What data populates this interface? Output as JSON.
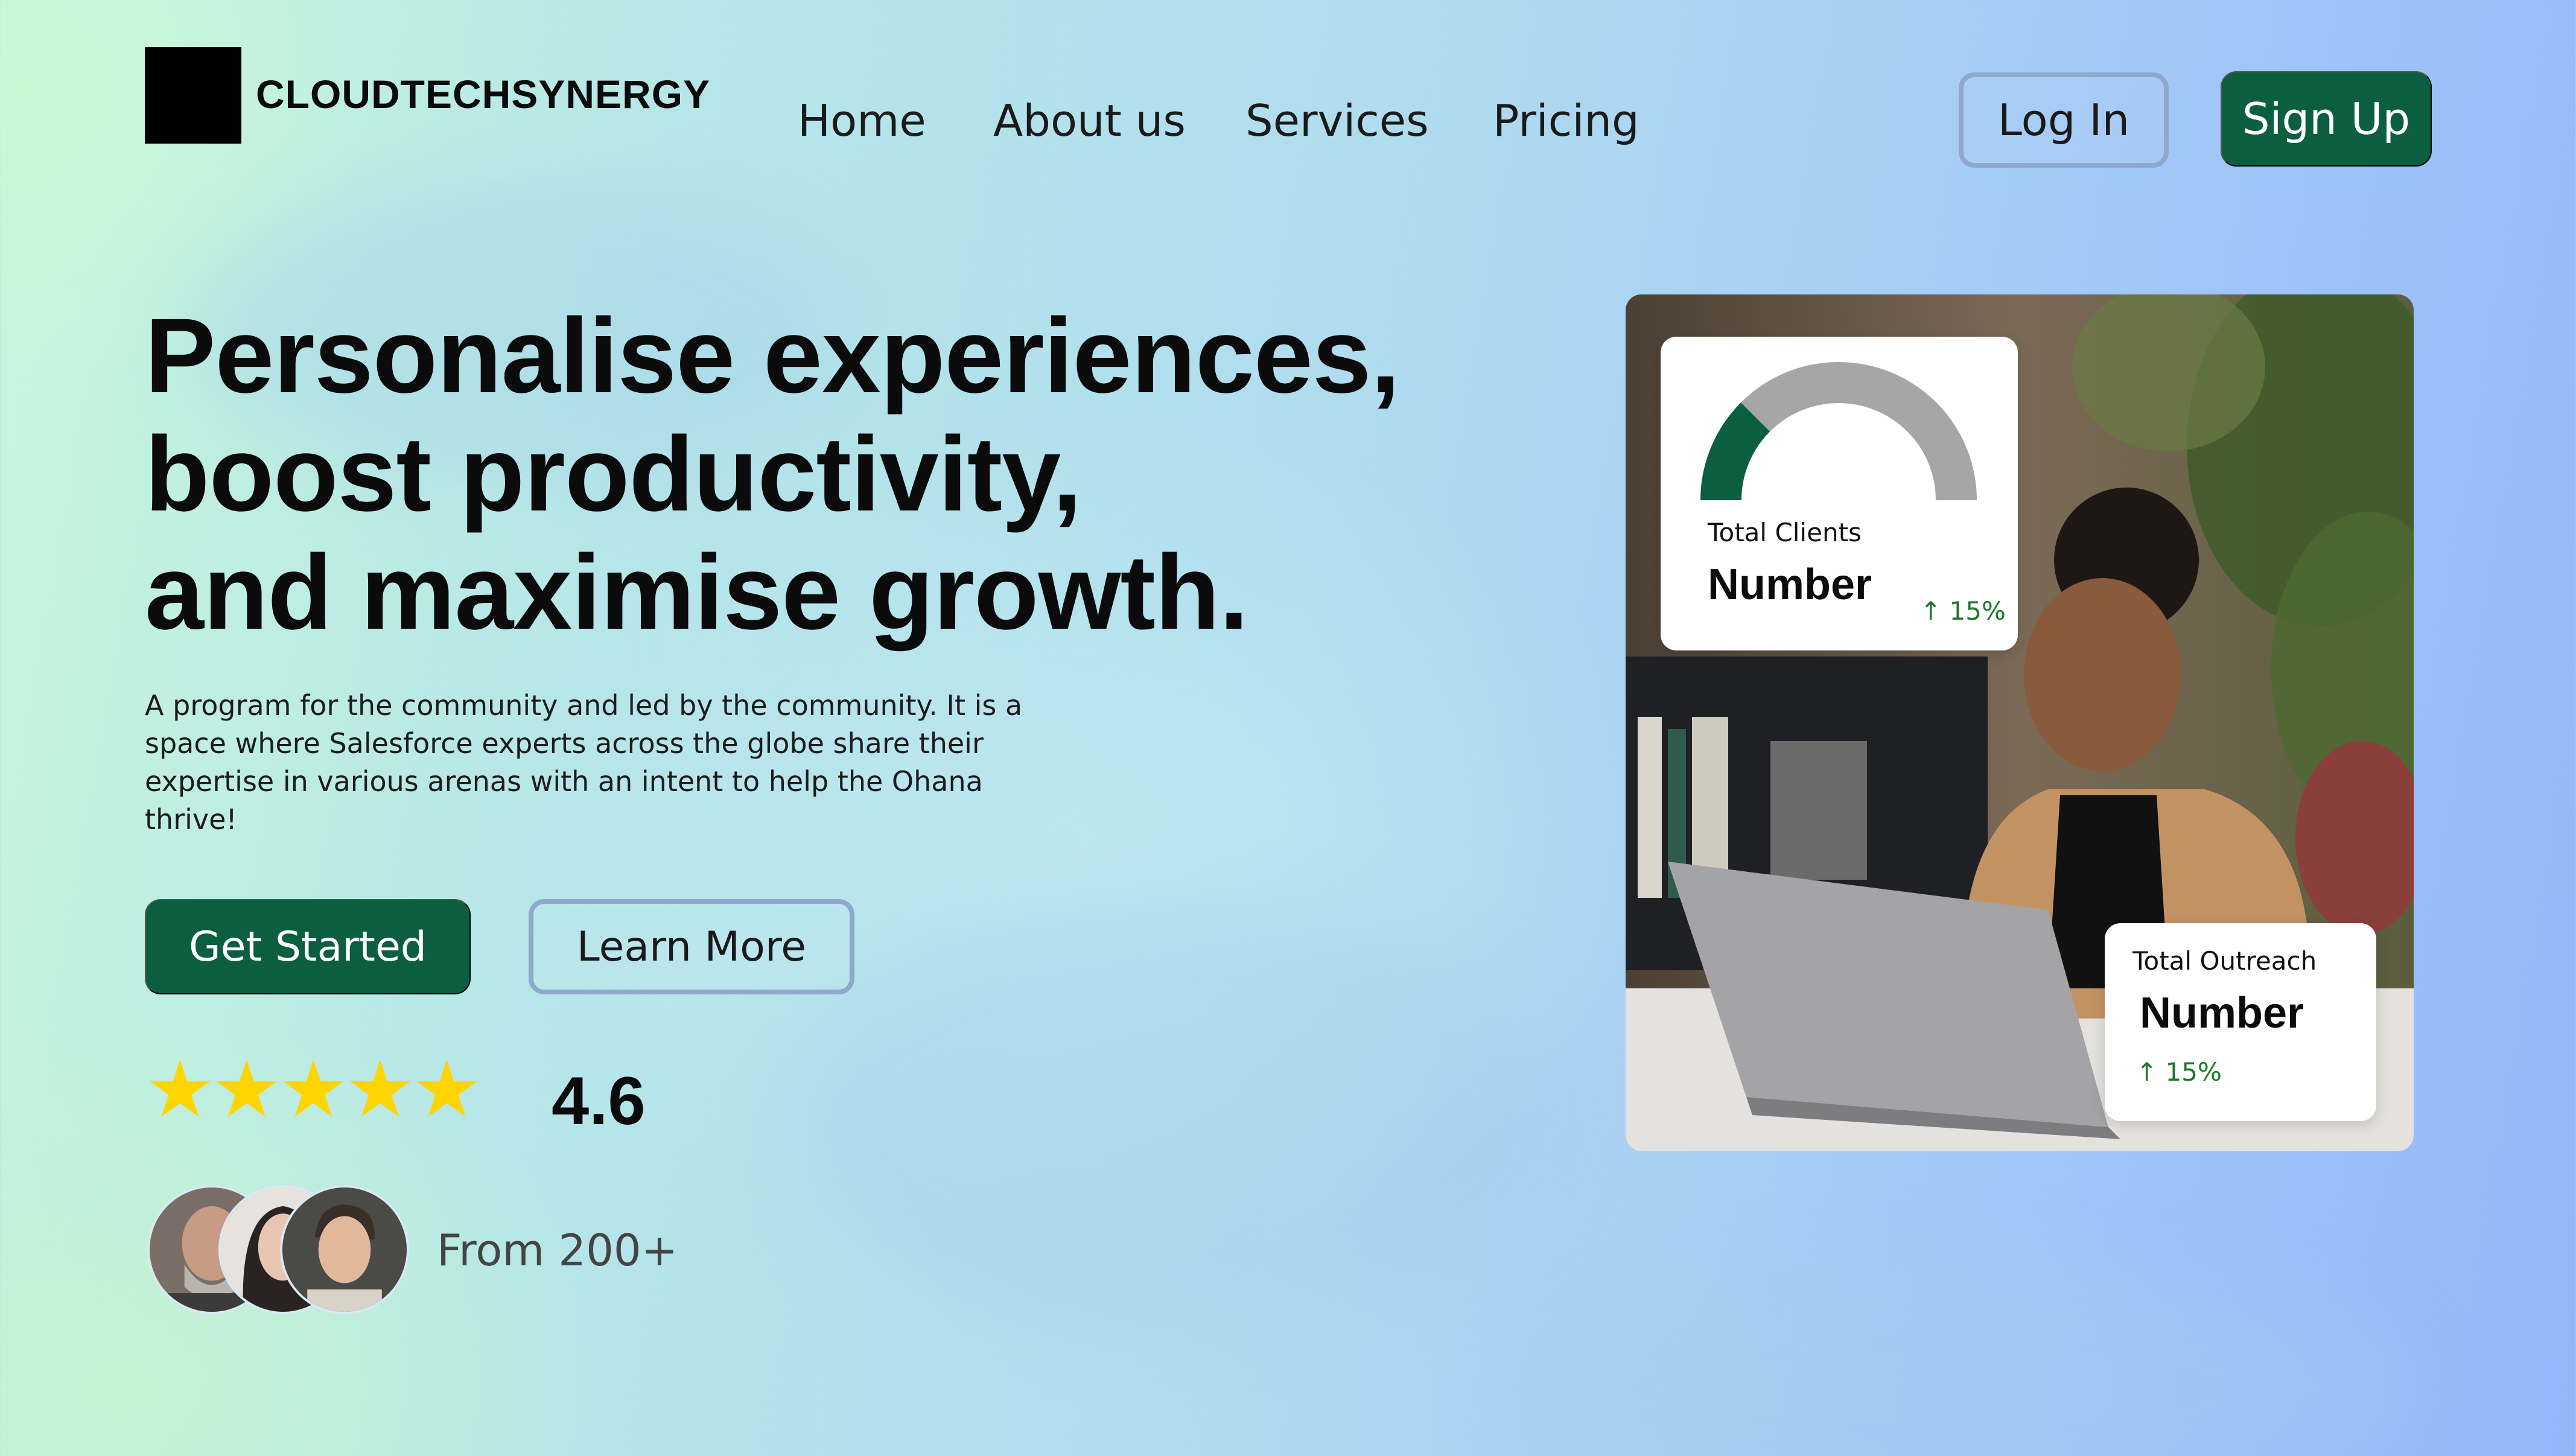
{
  "brand": {
    "name": "CLOUDTECHSYNERGY"
  },
  "nav": {
    "items": [
      "Home",
      "About us",
      "Services",
      "Pricing"
    ]
  },
  "auth": {
    "login_label": "Log In",
    "signup_label": "Sign Up"
  },
  "hero": {
    "headline_lines": [
      "Personalise experiences,",
      "boost productivity,",
      "and maximise growth."
    ],
    "description": "A program for the community and led by the community. It is a space where Salesforce experts across the globe share their expertise in various arenas with an intent to help the Ohana thrive!",
    "primary_cta": "Get Started",
    "secondary_cta": "Learn More",
    "stars": "★★★★★",
    "rating": "4.6",
    "rating_fraction": 0.92,
    "social_proof": "From 200+"
  },
  "cards": {
    "clients": {
      "label": "Total Clients",
      "number": "Number",
      "delta": "↑ 15%",
      "gauge_fraction": 0.2
    },
    "outreach": {
      "label": "Total Outreach",
      "number": "Number",
      "delta": "↑  15%"
    }
  },
  "colors": {
    "brand_green": "#0b5e3f",
    "star_yellow": "#ffd400",
    "gauge_grey": "#a6a6a6",
    "delta_green": "#1a7a2a"
  },
  "icons": [
    "logo-mark",
    "star-icon",
    "arrow-up-icon"
  ]
}
